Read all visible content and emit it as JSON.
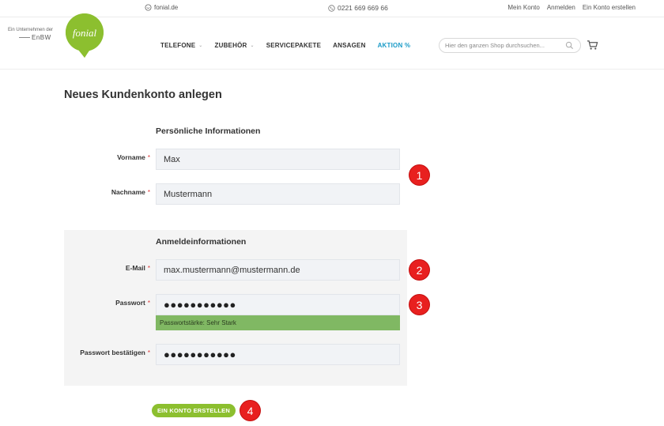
{
  "topbar": {
    "site": "fonial.de",
    "phone": "0221 669 669 66",
    "links": [
      "Mein Konto",
      "Anmelden",
      "Ein Konto erstellen"
    ]
  },
  "header": {
    "enbw_tagline": "Ein Unternehmen der",
    "enbw_brand": "EnBW",
    "logo_text": "fonial",
    "nav": [
      {
        "label": "TELEFONE",
        "has_dropdown": true
      },
      {
        "label": "ZUBEHÖR",
        "has_dropdown": true
      },
      {
        "label": "SERVICEPAKETE",
        "has_dropdown": false
      },
      {
        "label": "ANSAGEN",
        "has_dropdown": false
      },
      {
        "label": "AKTION %",
        "has_dropdown": false
      }
    ],
    "search_placeholder": "Hier den ganzen Shop durchsuchen..."
  },
  "form": {
    "title": "Neues Kundenkonto anlegen",
    "personal_section": "Persönliche Informationen",
    "firstname_label": "Vorname",
    "firstname_value": "Max",
    "lastname_label": "Nachname",
    "lastname_value": "Mustermann",
    "login_section": "Anmeldeinformationen",
    "email_label": "E-Mail",
    "email_value": "max.mustermann@mustermann.de",
    "password_label": "Passwort",
    "password_value": "●●●●●●●●●●●",
    "strength_text": "Passwortstärke: Sehr Stark",
    "confirm_label": "Passwort bestätigen",
    "confirm_value": "●●●●●●●●●●●",
    "required_mark": "*",
    "submit_label": "EIN KONTO ERSTELLEN"
  },
  "markers": [
    "1",
    "2",
    "3",
    "4"
  ],
  "colors": {
    "accent_green": "#8cbf2f",
    "strength_green": "#80b863",
    "action_blue": "#1a9bc7",
    "marker_red": "#e8201f"
  }
}
